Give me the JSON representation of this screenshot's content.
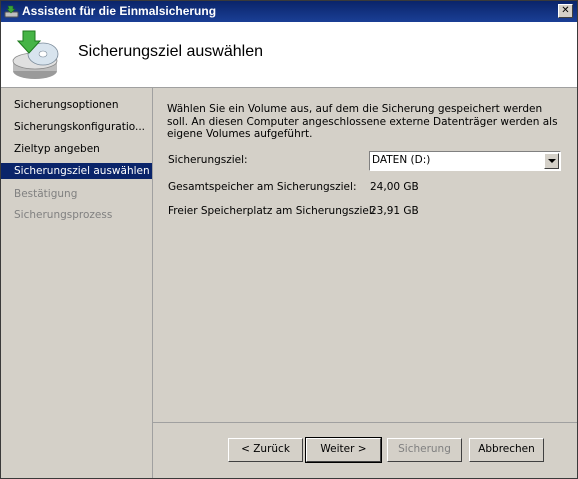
{
  "window": {
    "title": "Assistent für die Einmalsicherung",
    "close_glyph": "✕"
  },
  "header": {
    "title": "Sicherungsziel auswählen",
    "icon": "backup-disk-icon"
  },
  "nav": {
    "items": [
      {
        "label": "Sicherungsoptionen",
        "state": "normal"
      },
      {
        "label": "Sicherungskonfiguratio...",
        "state": "normal"
      },
      {
        "label": "Zieltyp angeben",
        "state": "normal"
      },
      {
        "label": "Sicherungsziel auswählen",
        "state": "selected"
      },
      {
        "label": "Bestätigung",
        "state": "disabled"
      },
      {
        "label": "Sicherungsprozess",
        "state": "disabled"
      }
    ]
  },
  "main": {
    "description": "Wählen Sie ein Volume aus, auf dem die Sicherung gespeichert werden soll. An diesen Computer angeschlossene externe Datenträger werden als eigene Volumes aufgeführt.",
    "target_label": "Sicherungsziel:",
    "target_value": "DATEN (D:)",
    "total_label": "Gesamtspeicher am Sicherungsziel:",
    "total_value": "24,00 GB",
    "free_label": "Freier Speicherplatz am Sicherungsziel:",
    "free_value": "23,91 GB"
  },
  "buttons": {
    "back": "< Zurück",
    "next": "Weiter >",
    "backup": "Sicherung",
    "cancel": "Abbrechen"
  }
}
